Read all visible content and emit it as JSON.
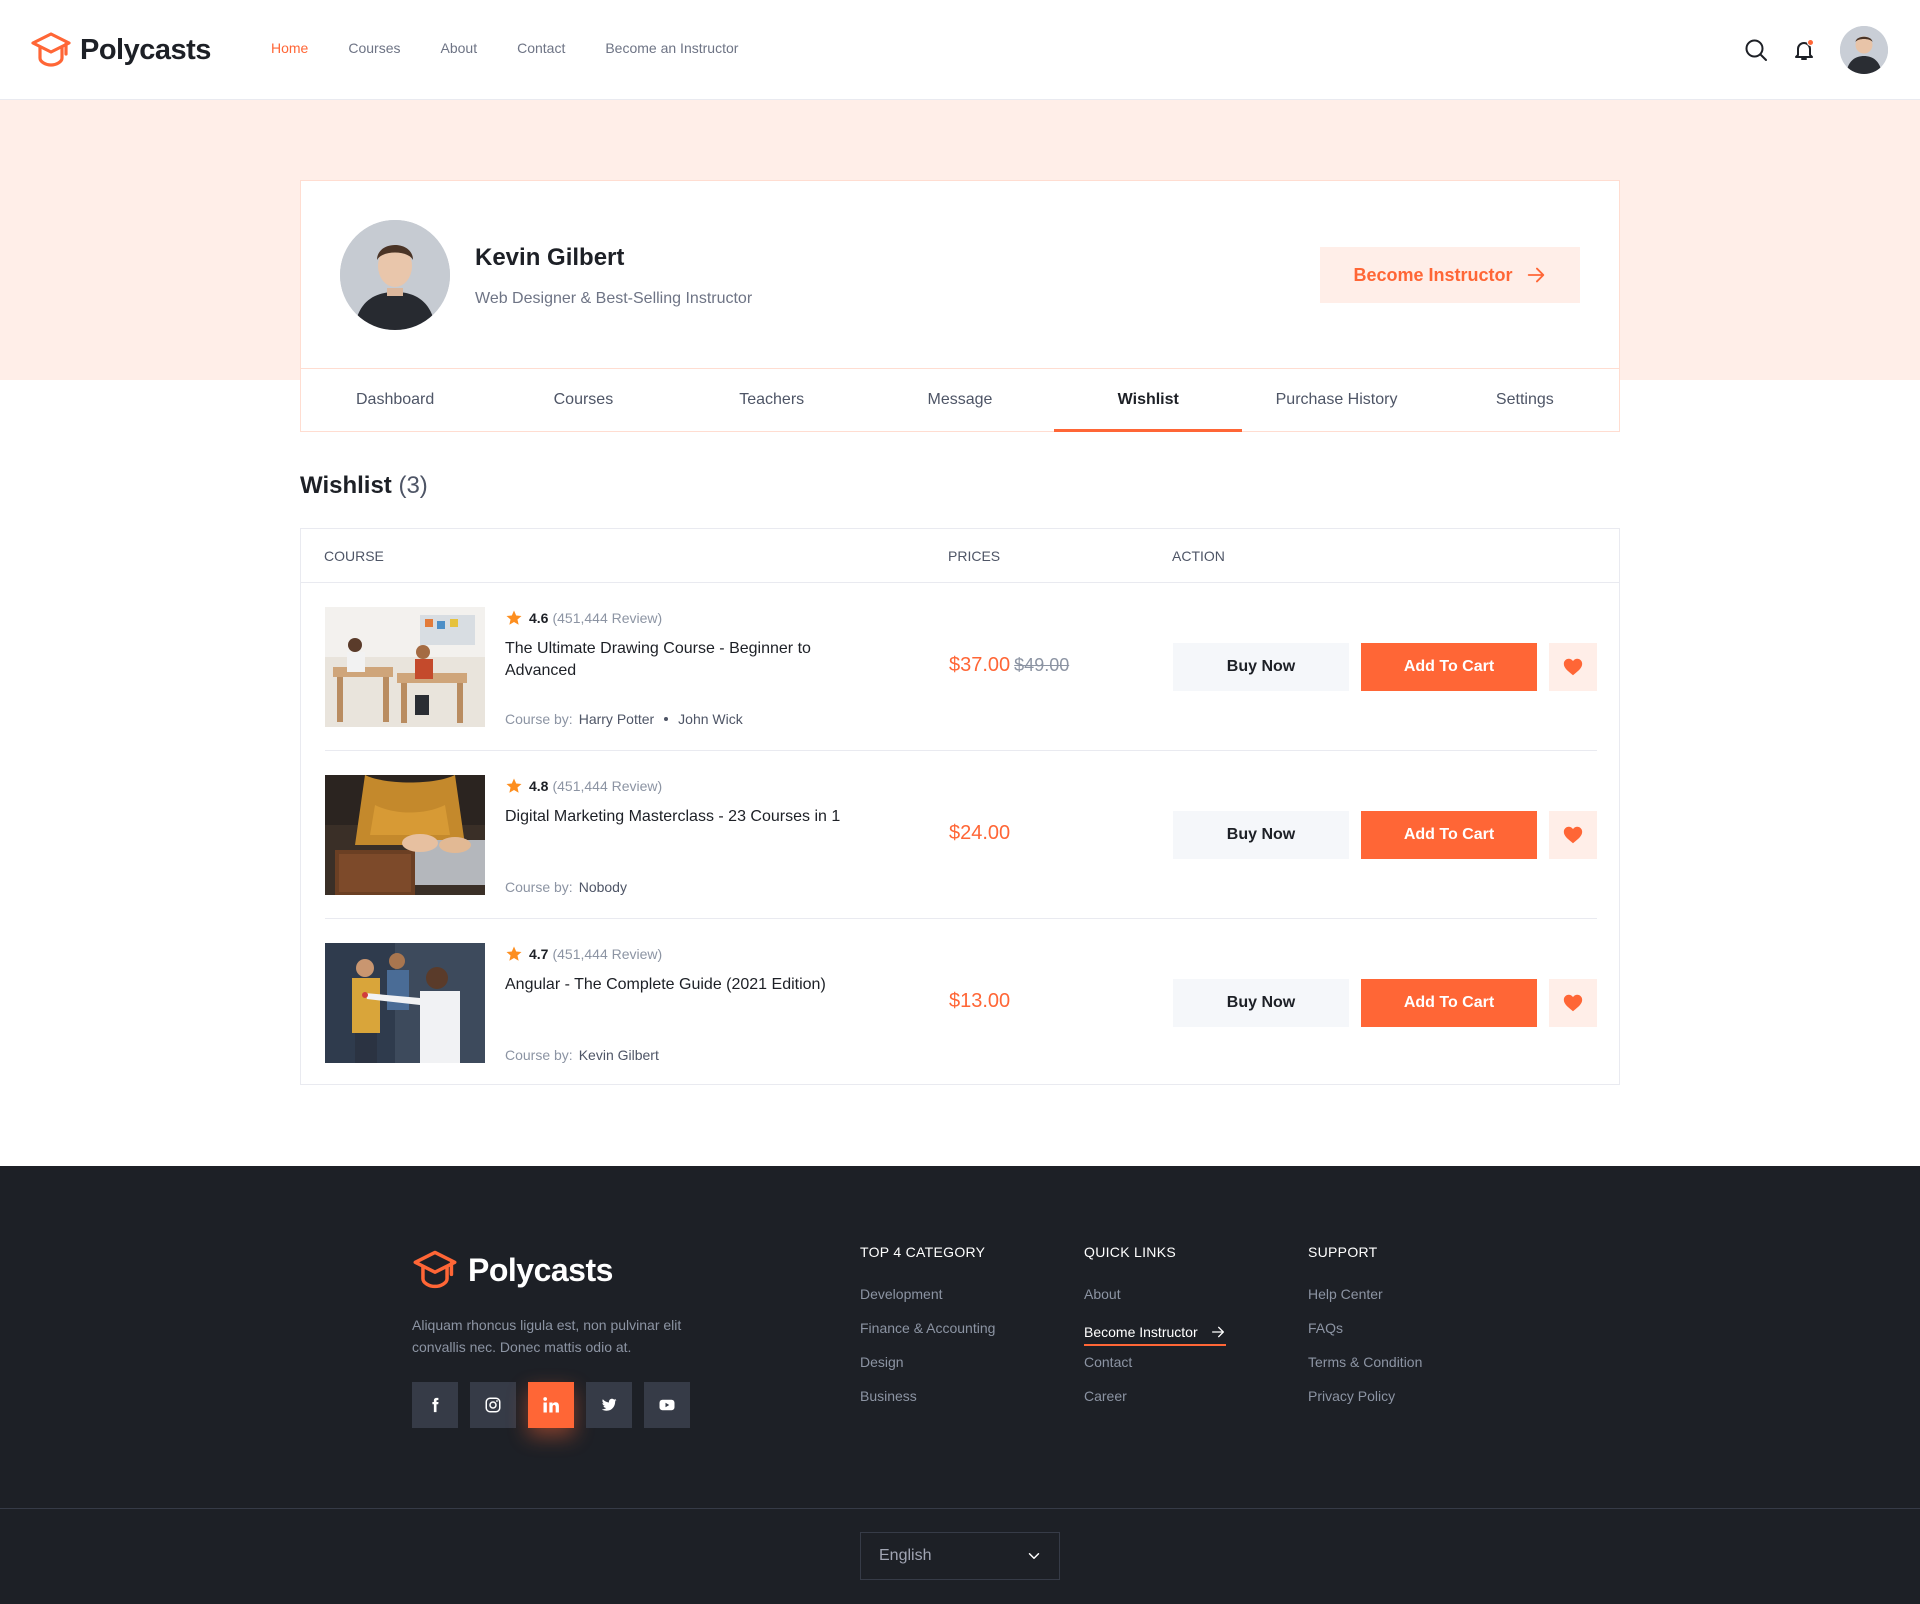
{
  "brand": {
    "name": "Polycasts",
    "accent": "#ff6636",
    "dark": "#1d2026"
  },
  "nav": {
    "items": [
      "Home",
      "Courses",
      "About",
      "Contact",
      "Become an Instructor"
    ],
    "active": "Home"
  },
  "header_icons": [
    "search-icon",
    "bell-icon",
    "avatar"
  ],
  "profile": {
    "name": "Kevin Gilbert",
    "role": "Web Designer & Best-Selling Instructor",
    "become_instructor_label": "Become Instructor"
  },
  "tabs": [
    "Dashboard",
    "Courses",
    "Teachers",
    "Message",
    "Wishlist",
    "Purchase History",
    "Settings"
  ],
  "active_tab": "Wishlist",
  "wishlist": {
    "title": "Wishlist",
    "count": "(3)",
    "columns": [
      "COURSE",
      "PRICES",
      "ACTION"
    ],
    "buy_label": "Buy Now",
    "cart_label": "Add To Cart",
    "course_by_label": "Course by:",
    "items": [
      {
        "rating": "4.6",
        "reviews": "(451,444 Review)",
        "title": "The Ultimate Drawing Course - Beginner to Advanced",
        "authors": [
          "Harry Potter",
          "John Wick"
        ],
        "price": "$37.00",
        "old_price": "$49.00"
      },
      {
        "rating": "4.8",
        "reviews": "(451,444 Review)",
        "title": "Digital Marketing Masterclass - 23 Courses in 1",
        "authors": [
          "Nobody"
        ],
        "price": "$24.00",
        "old_price": ""
      },
      {
        "rating": "4.7",
        "reviews": "(451,444 Review)",
        "title": "Angular - The Complete Guide (2021 Edition)",
        "authors": [
          "Kevin Gilbert"
        ],
        "price": "$13.00",
        "old_price": ""
      }
    ]
  },
  "footer": {
    "brand": "Polycasts",
    "description": "Aliquam rhoncus ligula est, non pulvinar elit convallis nec. Donec mattis odio at.",
    "socials": [
      "facebook-icon",
      "instagram-icon",
      "linkedin-icon",
      "twitter-icon",
      "youtube-icon"
    ],
    "active_social": "linkedin-icon",
    "columns": [
      {
        "title": "TOP 4 CATEGORY",
        "links": [
          "Development",
          "Finance & Accounting",
          "Design",
          "Business"
        ]
      },
      {
        "title": "QUICK LINKS",
        "links": [
          "About",
          "Become Instructor",
          "Contact",
          "Career"
        ],
        "highlight": "Become Instructor"
      },
      {
        "title": "SUPPORT",
        "links": [
          "Help Center",
          "FAQs",
          "Terms & Condition",
          "Privacy Policy"
        ]
      }
    ],
    "language": "English"
  }
}
